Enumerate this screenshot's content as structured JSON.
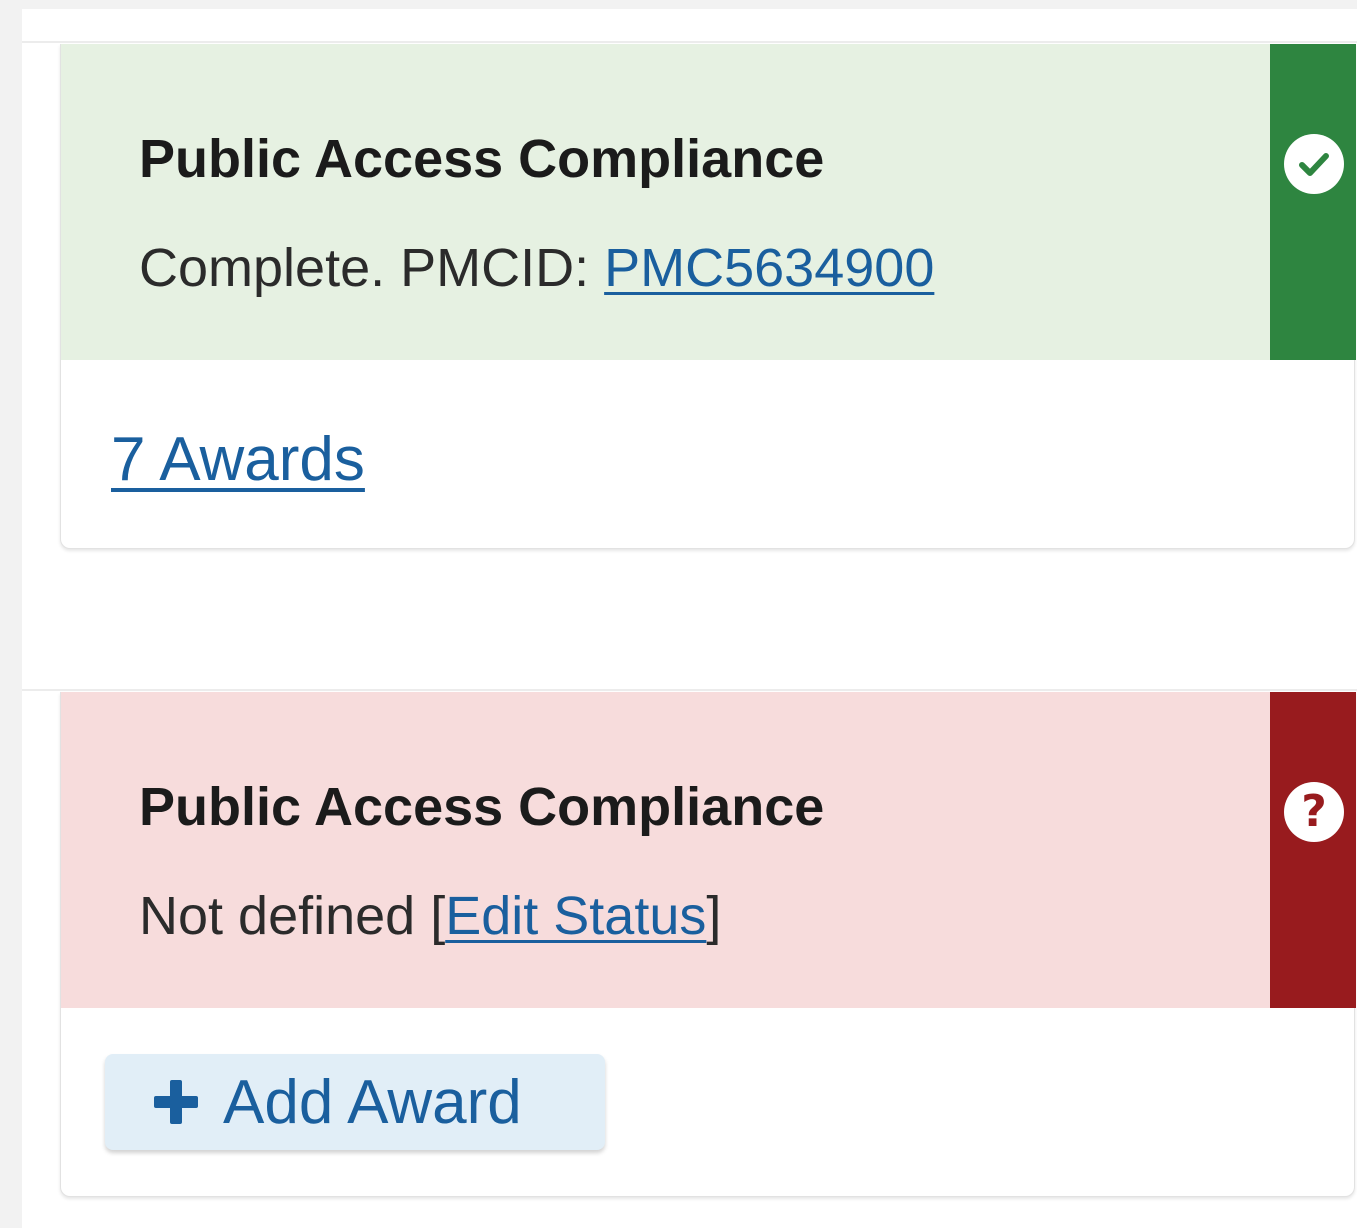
{
  "cards": [
    {
      "status": "complete",
      "title": "Public Access Compliance",
      "status_prefix": "Complete. PMCID: ",
      "pmcid_link": "PMC5634900",
      "awards_link": "7 Awards",
      "status_icon": "check-circle-icon",
      "colors": {
        "panel": "#e6f1e2",
        "bar": "#2e8540"
      }
    },
    {
      "status": "not-defined",
      "title": "Public Access Compliance",
      "status_prefix": "Not defined ",
      "bracket_open": "[",
      "edit_status_link": "Edit Status",
      "bracket_close": "]",
      "add_award_label": "Add Award",
      "add_award_icon": "plus-icon",
      "status_icon": "question-circle-icon",
      "status_icon_glyph": "?",
      "colors": {
        "panel": "#f7dcdc",
        "bar": "#981b1e"
      }
    }
  ],
  "colors": {
    "link": "#1a5f9e",
    "button_bg": "#e1eef7"
  }
}
